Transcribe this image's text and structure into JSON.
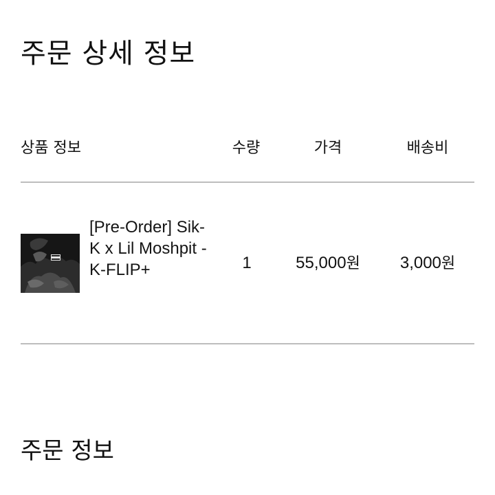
{
  "page": {
    "title": "주문 상세 정보"
  },
  "table": {
    "headers": {
      "product": "상품 정보",
      "quantity": "수량",
      "price": "가격",
      "shipping": "배송비"
    },
    "rows": [
      {
        "thumbnail_icon": "album-cover-image",
        "name": "[Pre-Order] Sik-K x Lil Moshpit - K-FLIP+",
        "quantity": "1",
        "price": "55,000",
        "price_unit": "원",
        "shipping": "3,000",
        "shipping_unit": "원"
      }
    ]
  },
  "order_info": {
    "title": "주문 정보"
  },
  "colors": {
    "text": "#111111",
    "divider": "#bdbdbd",
    "background": "#ffffff"
  }
}
